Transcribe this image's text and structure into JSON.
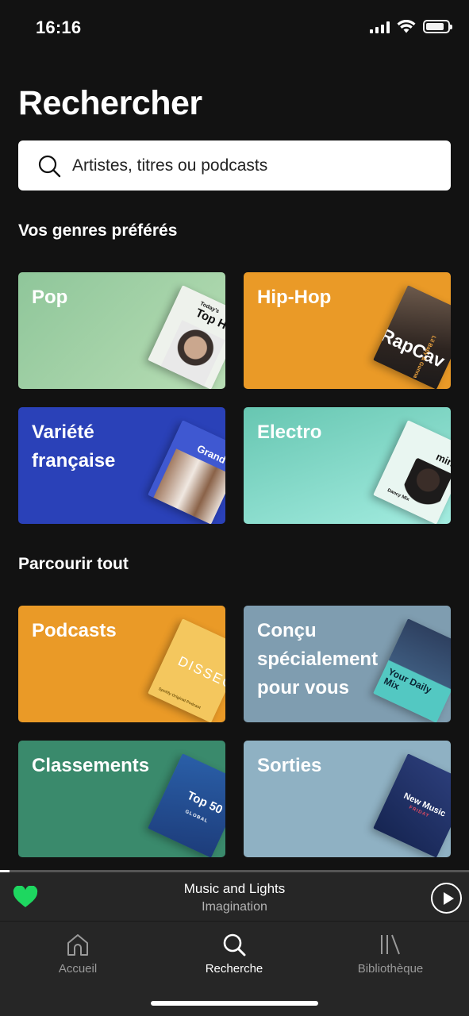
{
  "status": {
    "time": "16:16"
  },
  "page": {
    "title": "Rechercher"
  },
  "search": {
    "placeholder": "Artistes, titres ou podcasts"
  },
  "sections": {
    "favorites_title": "Vos genres préférés",
    "browse_title": "Parcourir tout"
  },
  "favorites": [
    {
      "label": "Pop",
      "art_text": "Top H",
      "art_caption": "Today's",
      "color": "#8fc69a"
    },
    {
      "label": "Hip-Hop",
      "art_text": "RapCav",
      "art_caption": "Lil Baby & Gunna",
      "color": "#ea9a27"
    },
    {
      "label": "Variété française",
      "art_text": "Grand",
      "color": "#2a41b8"
    },
    {
      "label": "Electro",
      "art_text": "min",
      "art_caption": "Dancy Mix",
      "color": "#67c6b1"
    }
  ],
  "browse": [
    {
      "label": "Podcasts",
      "art_text": "DISSEC",
      "art_caption": "Spotify Original Podcast",
      "color": "#ea9a27"
    },
    {
      "label": "Conçu spécialement pour vous",
      "art_text": "Your Daily Mix",
      "color": "#7f9db0"
    },
    {
      "label": "Classements",
      "art_text": "Top 50",
      "art_caption": "GLOBAL",
      "color": "#3a8a6c"
    },
    {
      "label": "Sorties",
      "art_text": "New Music",
      "art_caption": "FRIDAY",
      "color": "#8fb1c3"
    }
  ],
  "player": {
    "track": "Music and Lights",
    "artist": "Imagination",
    "progress": 0.02,
    "liked": true
  },
  "tabs": [
    {
      "label": "Accueil",
      "icon": "home-icon",
      "active": false
    },
    {
      "label": "Recherche",
      "icon": "search-icon",
      "active": true
    },
    {
      "label": "Bibliothèque",
      "icon": "library-icon",
      "active": false
    }
  ],
  "colors": {
    "accent": "#1ed760",
    "background": "#121212"
  }
}
